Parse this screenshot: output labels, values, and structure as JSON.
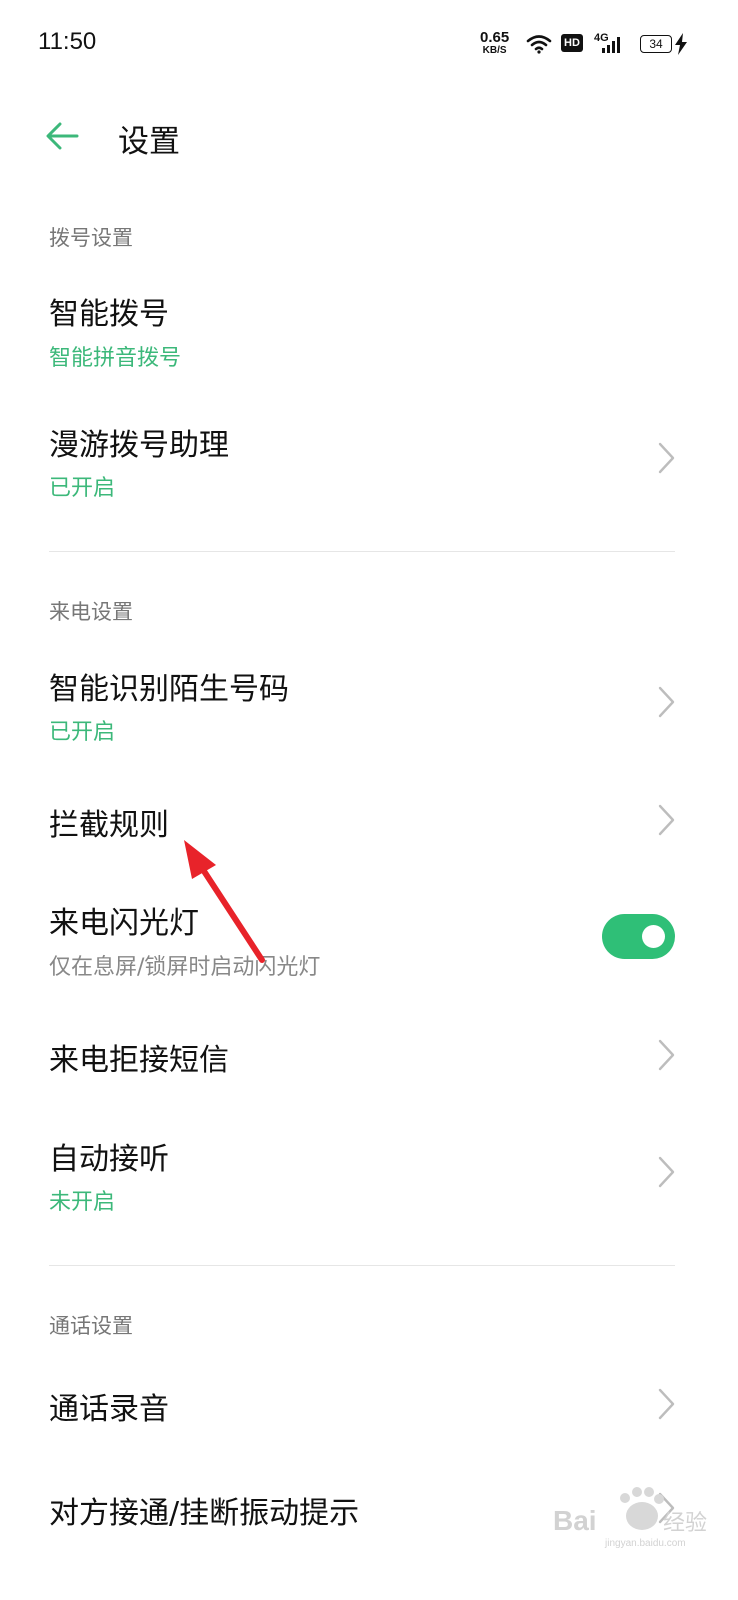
{
  "status_bar": {
    "time": "11:50",
    "net_speed_value": "0.65",
    "net_speed_unit": "KB/S",
    "hd": "HD",
    "network": "4G",
    "battery": "34"
  },
  "header": {
    "title": "设置"
  },
  "sections": {
    "dial": {
      "label": "拨号设置",
      "smart_dial": {
        "title": "智能拨号",
        "sub": "智能拼音拨号"
      },
      "roaming": {
        "title": "漫游拨号助理",
        "sub": "已开启"
      }
    },
    "incoming": {
      "label": "来电设置",
      "identify": {
        "title": "智能识别陌生号码",
        "sub": "已开启"
      },
      "block_rules": {
        "title": "拦截规则"
      },
      "flash": {
        "title": "来电闪光灯",
        "sub": "仅在息屏/锁屏时启动闪光灯",
        "enabled": true
      },
      "reject_sms": {
        "title": "来电拒接短信"
      },
      "auto_answer": {
        "title": "自动接听",
        "sub": "未开启"
      }
    },
    "call": {
      "label": "通话设置",
      "recording": {
        "title": "通话录音"
      },
      "vibration": {
        "title": "对方接通/挂断振动提示"
      }
    }
  },
  "watermark": {
    "text": "Baidu经验",
    "sub": "jingyan.baidu.com"
  },
  "colors": {
    "accent": "#3cb87a",
    "toggle_on": "#2fbf77",
    "annotation_arrow": "#e8232a"
  }
}
